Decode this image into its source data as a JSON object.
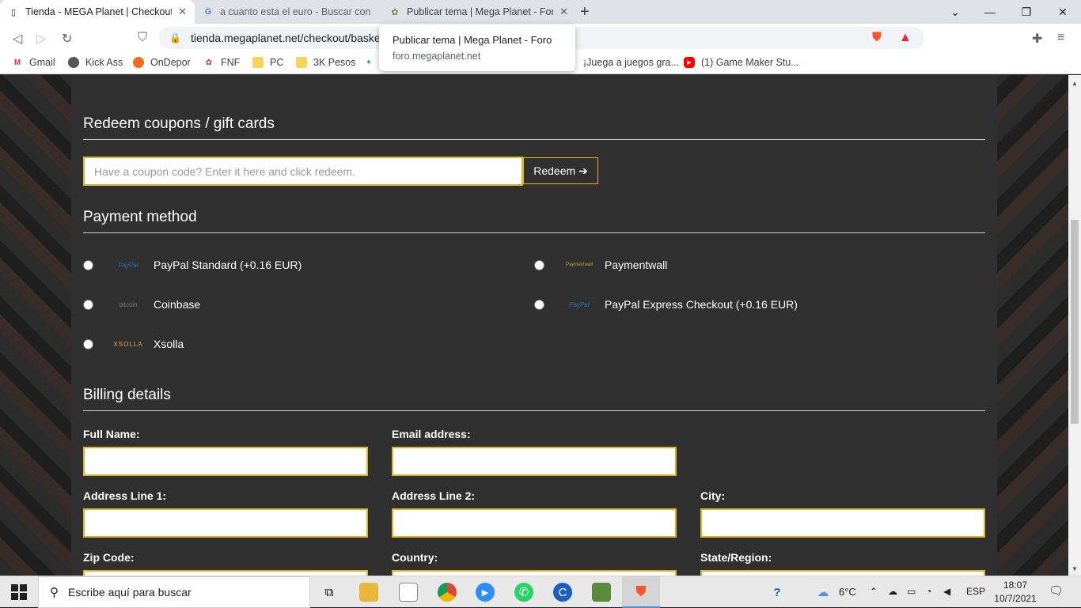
{
  "browser": {
    "tabs": [
      {
        "title": "Tienda - MEGA Planet | Checkout",
        "favicon": "doc-icon"
      },
      {
        "title": "a cuanto esta el euro - Buscar con Google",
        "favicon": "google-icon"
      },
      {
        "title": "Publicar tema | Mega Planet - Foro",
        "favicon": "forum-icon"
      }
    ],
    "url": "tienda.megaplanet.net/checkout/basket",
    "tooltip": {
      "title": "Publicar tema | Mega Planet - Foro",
      "domain": "foro.megaplanet.net"
    },
    "bookmarks": [
      {
        "label": "Gmail"
      },
      {
        "label": "Kick Ass"
      },
      {
        "label": "OnDepor"
      },
      {
        "label": "FNF"
      },
      {
        "label": "PC"
      },
      {
        "label": "3K Pesos"
      },
      {
        "label": "¡Juega a juegos gra..."
      },
      {
        "label": "(1) Game Maker Stu..."
      }
    ]
  },
  "checkout": {
    "coupons": {
      "title": "Redeem coupons / gift cards",
      "placeholder": "Have a coupon code? Enter it here and click redeem.",
      "button": "Redeem ➔"
    },
    "payment": {
      "title": "Payment method",
      "methods": [
        {
          "label": "PayPal Standard (+0.16 EUR)",
          "logo": "PayPal"
        },
        {
          "label": "Paymentwall",
          "logo": "Paymentwall"
        },
        {
          "label": "Coinbase",
          "logo": "bitcoin"
        },
        {
          "label": "PayPal Express Checkout (+0.16 EUR)",
          "logo": "PayPal"
        },
        {
          "label": "Xsolla",
          "logo": "XSOLLA"
        }
      ]
    },
    "billing": {
      "title": "Billing details",
      "fields": {
        "full_name": "Full Name:",
        "email": "Email address:",
        "address1": "Address Line 1:",
        "address2": "Address Line 2:",
        "city": "City:",
        "zip": "Zip Code:",
        "country": "Country:",
        "state": "State/Region:"
      }
    }
  },
  "taskbar": {
    "search_placeholder": "Escribe aquí para buscar",
    "weather": "6°C",
    "language": "ESP",
    "time": "18:07",
    "date": "10/7/2021"
  },
  "colors": {
    "accent": "#e0b224",
    "panel": "#303030"
  }
}
